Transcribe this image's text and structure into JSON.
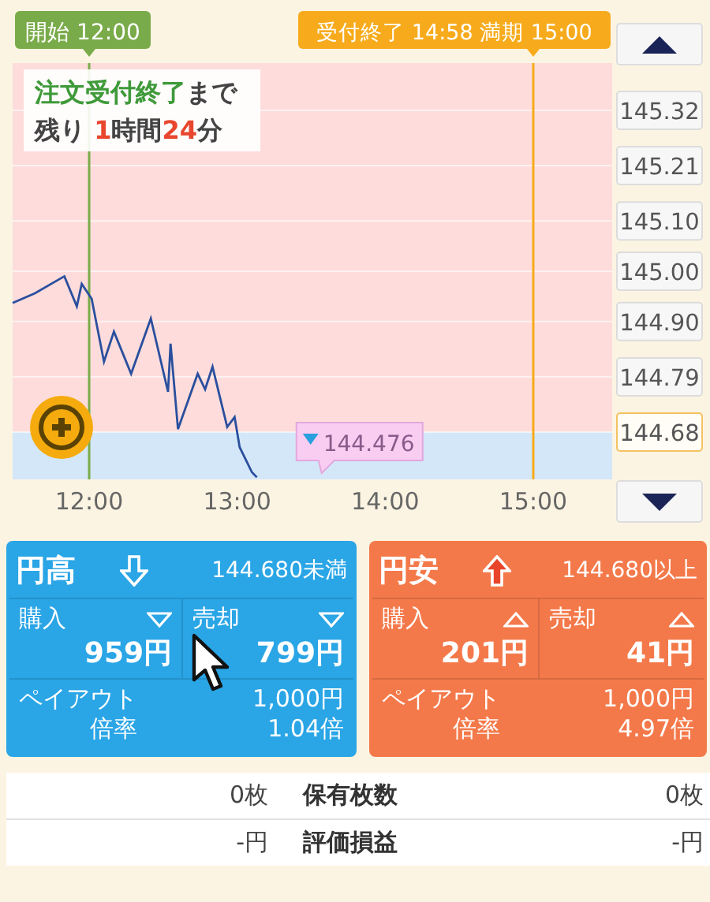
{
  "chart": {
    "countdown": [
      [
        {
          "text": "注文受付終了",
          "color": "#3f9a3a"
        },
        {
          "text": "まで",
          "color": "#444444"
        }
      ],
      [
        {
          "text": "残り ",
          "color": "#444444"
        },
        {
          "text": "1",
          "color": "#e8462e"
        },
        {
          "text": "時間",
          "color": "#444444"
        },
        {
          "text": "24",
          "color": "#e8462e"
        },
        {
          "text": "分",
          "color": "#444444"
        }
      ]
    ],
    "price_label": "144.476",
    "chart_data": {
      "type": "line",
      "x": [
        11.483,
        11.633,
        11.833,
        11.917,
        11.95,
        12.017,
        12.1,
        12.167,
        12.283,
        12.417,
        12.533,
        12.55,
        12.6,
        12.733,
        12.783,
        12.833,
        12.933,
        12.983,
        13.017,
        13.1,
        13.133
      ],
      "series": [
        {
          "color": "#2a4f9e",
          "values": [
            144.937,
            144.956,
            144.99,
            144.93,
            144.975,
            144.945,
            144.82,
            144.88,
            144.796,
            144.906,
            144.76,
            144.856,
            144.686,
            144.796,
            144.765,
            144.81,
            144.69,
            144.71,
            144.65,
            144.6,
            144.59
          ]
        }
      ],
      "xlim": [
        11.483,
        15.533
      ],
      "ylim": [
        144.586,
        145.414
      ],
      "xticks": [
        {
          "value": 12,
          "label": "12:00"
        },
        {
          "value": 13,
          "label": "13:00"
        },
        {
          "value": 14,
          "label": "14:00"
        },
        {
          "value": 15,
          "label": "15:00"
        }
      ],
      "yticks": [
        {
          "value": 145.32,
          "label": "145.32"
        },
        {
          "value": 145.21,
          "label": "145.21"
        },
        {
          "value": 145.1,
          "label": "145.10"
        },
        {
          "value": 145.0,
          "label": "145.00"
        },
        {
          "value": 144.9,
          "label": "144.90"
        },
        {
          "value": 144.79,
          "label": "144.79"
        },
        {
          "value": 144.68,
          "label": "144.68"
        }
      ],
      "grid": true,
      "ref_lines": [
        {
          "axis": "x",
          "value": 12,
          "color": "#7aab4a",
          "label": "開始 12:00"
        },
        {
          "axis": "x",
          "value": 15,
          "color": "#f7ab1c",
          "label": "受付終了 14:58 満期 15:00"
        }
      ],
      "bands": [
        {
          "axis": "y",
          "from": 144.68,
          "to": 145.414,
          "color": "#fddcdb"
        },
        {
          "axis": "y",
          "from": 144.586,
          "to": 144.68,
          "color": "#d3e7f8"
        }
      ]
    }
  },
  "options": [
    {
      "kind": "low",
      "title": "円高",
      "condition": "144.680未満",
      "buy_label": "購入",
      "buy_price": "959円",
      "sell_label": "売却",
      "sell_price": "799円",
      "payout_label": "ペイアウト",
      "payout": "1,000円",
      "rate_label": "倍率",
      "rate": "1.04倍"
    },
    {
      "kind": "high",
      "title": "円安",
      "condition": "144.680以上",
      "buy_label": "購入",
      "buy_price": "201円",
      "sell_label": "売却",
      "sell_price": "41円",
      "payout_label": "ペイアウト",
      "payout": "1,000円",
      "rate_label": "倍率",
      "rate": "4.97倍"
    }
  ],
  "holdings": [
    {
      "left": "0枚",
      "label": "保有枚数",
      "right": "0枚"
    },
    {
      "left": "-円",
      "label": "評価損益",
      "right": "-円"
    }
  ]
}
